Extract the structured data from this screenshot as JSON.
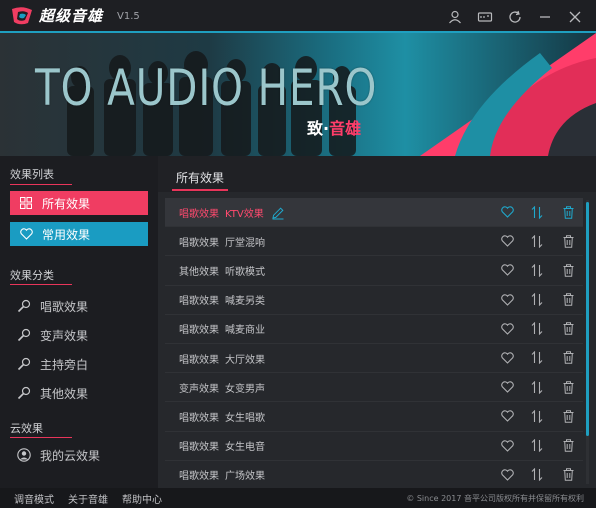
{
  "app": {
    "title": "超级音雄",
    "version": "V1.5"
  },
  "banner": {
    "title": "TO AUDIO HERO",
    "sub_prefix": "致·",
    "sub_name": "音雄"
  },
  "sidebar": {
    "list_header": "效果列表",
    "all_effects": "所有效果",
    "favorites": "常用效果",
    "category_header": "效果分类",
    "categories": [
      {
        "label": "唱歌效果",
        "icon": "mic-icon"
      },
      {
        "label": "变声效果",
        "icon": "mic-icon"
      },
      {
        "label": "主持旁白",
        "icon": "mic-icon"
      },
      {
        "label": "其他效果",
        "icon": "mic-icon"
      }
    ],
    "cloud_header": "云效果",
    "my_cloud": "我的云效果"
  },
  "main": {
    "tab_label": "所有效果",
    "rows": [
      {
        "category": "唱歌效果",
        "name": "KTV效果",
        "selected": true
      },
      {
        "category": "唱歌效果",
        "name": "厅堂混响"
      },
      {
        "category": "其他效果",
        "name": "听歌模式"
      },
      {
        "category": "唱歌效果",
        "name": "喊麦另类"
      },
      {
        "category": "唱歌效果",
        "name": "喊麦商业"
      },
      {
        "category": "唱歌效果",
        "name": "大厅效果"
      },
      {
        "category": "变声效果",
        "name": "女变男声"
      },
      {
        "category": "唱歌效果",
        "name": "女生唱歌"
      },
      {
        "category": "唱歌效果",
        "name": "女生电音"
      },
      {
        "category": "唱歌效果",
        "name": "广场效果"
      }
    ]
  },
  "footer": {
    "tuning_mode": "调音模式",
    "about": "关于音雄",
    "help": "帮助中心",
    "copyright": "© Since 2017 音平公司版权所有并保留所有权利"
  },
  "colors": {
    "accent_pink": "#f03d62",
    "accent_blue": "#1a9cc2",
    "bg": "#1b1c20"
  }
}
